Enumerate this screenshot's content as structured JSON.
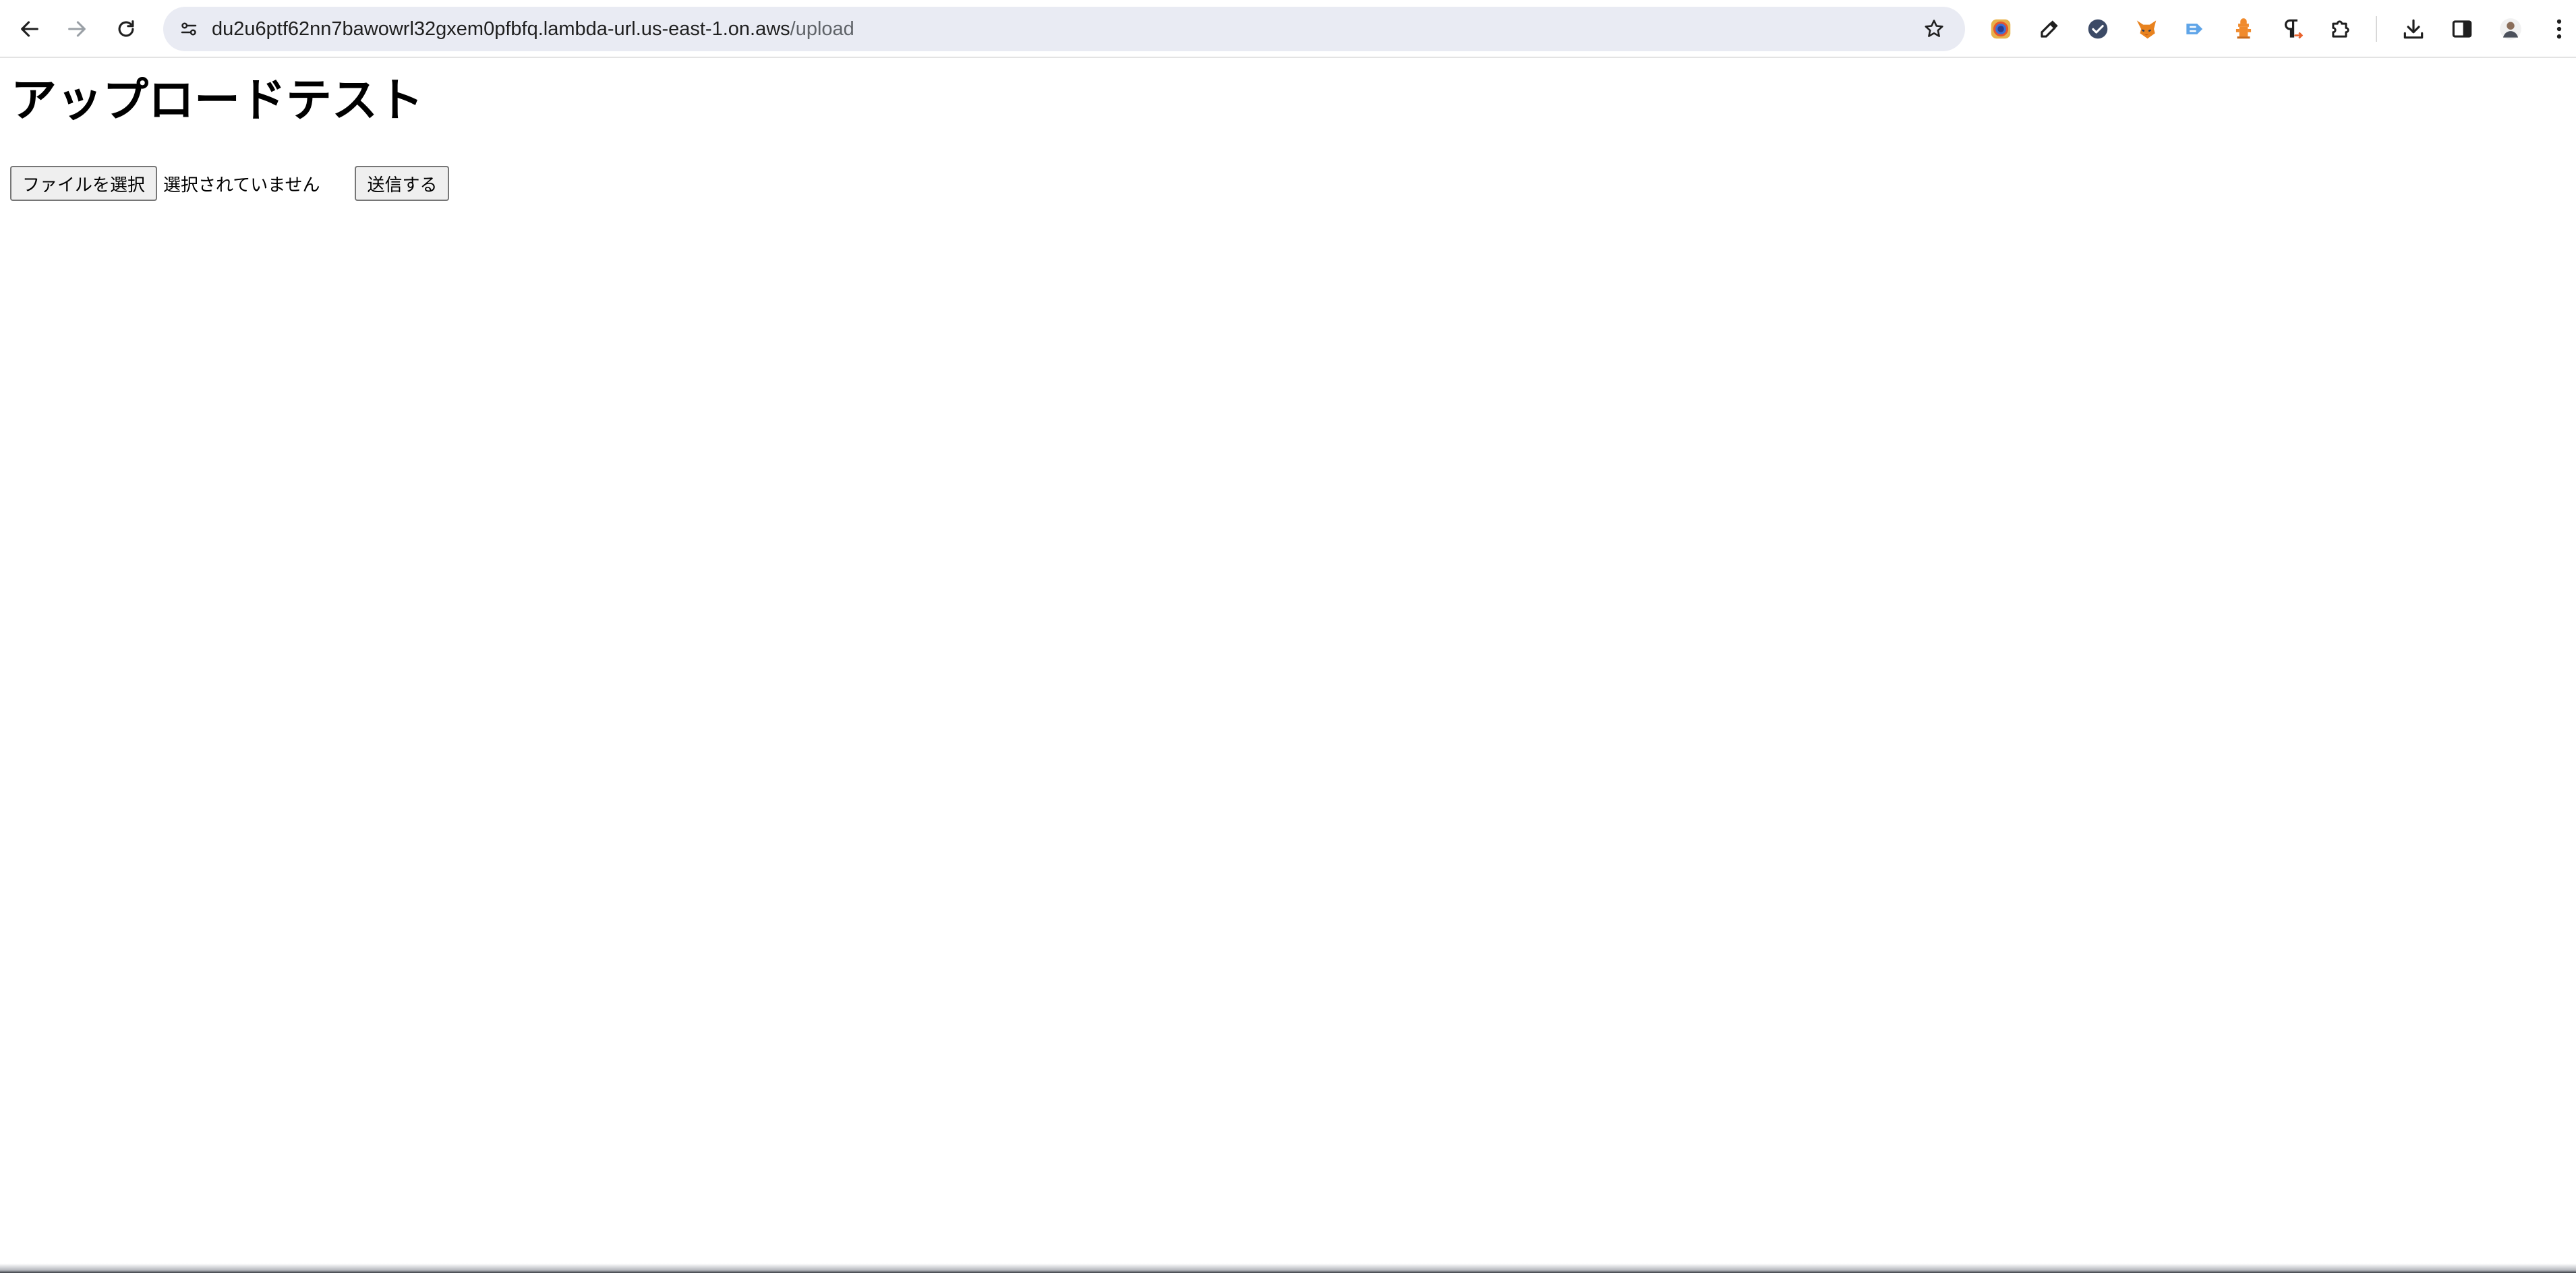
{
  "browser": {
    "url_host": "du2u6ptf62nn7bawowrl32gxem0pfbfq.lambda-url.us-east-1.on.aws",
    "url_path": "/upload",
    "icons": {
      "back": "arrow-left-icon",
      "forward": "arrow-right-icon",
      "reload": "reload-icon",
      "site_info": "tune-icon",
      "bookmark": "star-icon",
      "extensions": [
        "color-picker-icon",
        "eyedropper-icon",
        "check-circle-icon",
        "fox-icon",
        "tag-icon",
        "fire-hydrant-icon",
        "pilcrow-icon",
        "puzzle-icon"
      ],
      "downloads": "download-icon",
      "side_panel": "side-panel-icon",
      "profile": "avatar",
      "menu": "kebab-menu-icon"
    }
  },
  "page": {
    "title": "アップロードテスト",
    "file_button_label": "ファイルを選択",
    "no_file_text": "選択されていません",
    "submit_label": "送信する"
  },
  "colors": {
    "omnibox_bg": "#e9ebf3",
    "button_bg": "#efefef",
    "button_border": "#767676"
  }
}
